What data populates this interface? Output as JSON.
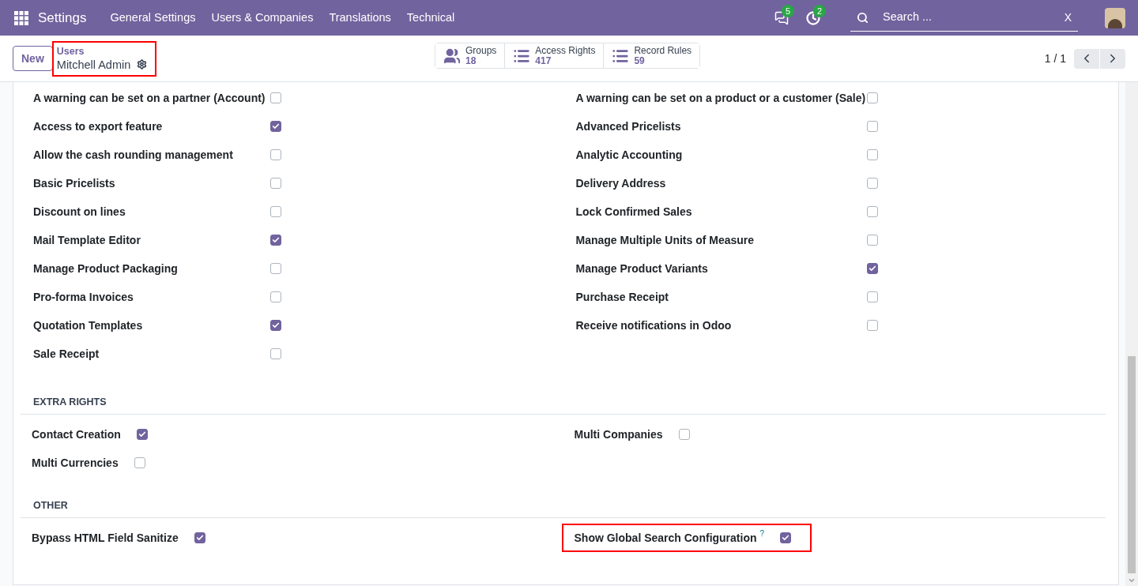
{
  "navbar": {
    "app": "Settings",
    "menu": [
      "General Settings",
      "Users & Companies",
      "Translations",
      "Technical"
    ],
    "badges": [
      {
        "kind": "chat",
        "count": "5"
      },
      {
        "kind": "activity",
        "count": "2"
      }
    ],
    "search": {
      "placeholder": "Search ...",
      "clear": "X"
    }
  },
  "control_panel": {
    "new": "New",
    "breadcrumb": "Users",
    "record": "Mitchell Admin",
    "highlighted": true,
    "smart_buttons": [
      {
        "kind": "groups",
        "label": "Groups",
        "count": "18"
      },
      {
        "kind": "list",
        "label": "Access Rights",
        "count": "417"
      },
      {
        "kind": "list",
        "label": "Record Rules",
        "count": "59"
      }
    ],
    "pager": "1 / 1"
  },
  "settings": {
    "left": [
      {
        "label": "A warning can be set on a partner (Account)",
        "checked": false
      },
      {
        "label": "Access to export feature",
        "checked": true
      },
      {
        "label": "Allow the cash rounding management",
        "checked": false
      },
      {
        "label": "Basic Pricelists",
        "checked": false
      },
      {
        "label": "Discount on lines",
        "checked": false
      },
      {
        "label": "Mail Template Editor",
        "checked": true
      },
      {
        "label": "Manage Product Packaging",
        "checked": false
      },
      {
        "label": "Pro-forma Invoices",
        "checked": false
      },
      {
        "label": "Quotation Templates",
        "checked": true
      },
      {
        "label": "Sale Receipt",
        "checked": false
      }
    ],
    "right": [
      {
        "label": "A warning can be set on a product or a customer (Sale)",
        "checked": false
      },
      {
        "label": "Advanced Pricelists",
        "checked": false
      },
      {
        "label": "Analytic Accounting",
        "checked": false
      },
      {
        "label": "Delivery Address",
        "checked": false
      },
      {
        "label": "Lock Confirmed Sales",
        "checked": false
      },
      {
        "label": "Manage Multiple Units of Measure",
        "checked": false
      },
      {
        "label": "Manage Product Variants",
        "checked": true
      },
      {
        "label": "Purchase Receipt",
        "checked": false
      },
      {
        "label": "Receive notifications in Odoo",
        "checked": false
      }
    ]
  },
  "sections": [
    {
      "title": "EXTRA RIGHTS",
      "left": [
        {
          "label": "Contact Creation",
          "checked": true,
          "highlighted": false
        },
        {
          "label": "Multi Currencies",
          "checked": false,
          "highlighted": false
        }
      ],
      "right": [
        {
          "label": "Multi Companies",
          "checked": false,
          "highlighted": false
        }
      ]
    },
    {
      "title": "OTHER",
      "left": [
        {
          "label": "Bypass HTML Field Sanitize",
          "checked": true,
          "highlighted": false
        }
      ],
      "right": [
        {
          "label": "Show Global Search Configuration",
          "help": "?",
          "checked": true,
          "highlighted": true
        }
      ]
    }
  ]
}
